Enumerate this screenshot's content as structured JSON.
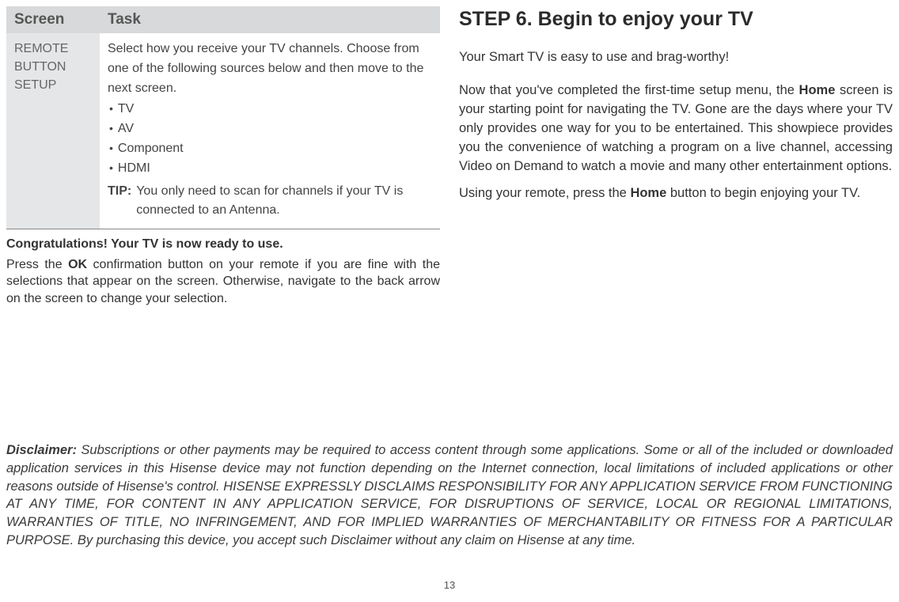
{
  "table": {
    "headers": {
      "screen": "Screen",
      "task": "Task"
    },
    "row": {
      "screen": "REMOTE BUTTON SETUP",
      "task_intro": "Select how you receive your TV channels. Choose from one of the following sources below and then move to the next screen.",
      "bullets": [
        "TV",
        "AV",
        "Component",
        "HDMI"
      ],
      "tip_label": "TIP:",
      "tip_text": "You only need to scan for channels if your TV is connected to an Antenna."
    }
  },
  "below": {
    "congrats": "Congratulations! Your TV is now ready to use.",
    "press_pre": "Press the ",
    "ok": "OK",
    "press_post": " confirmation button on your remote if you are fine with the selections that appear on the screen. Otherwise, navigate to the back arrow on the screen to change your selection."
  },
  "right": {
    "heading": "STEP 6. Begin to enjoy your TV",
    "p1": "Your Smart TV is easy to use and brag-worthy!",
    "p2_pre": "Now that you've completed the first-time setup menu, the ",
    "p2_home": "Home",
    "p2_post": " screen is your starting point for navigating the TV. Gone are the days where your TV only provides one way for you to be entertained. This showpiece provides you the convenience of watching a program on a live channel, accessing Video on Demand to watch a movie and many other entertainment options.",
    "p3_pre": "Using your remote, press the ",
    "p3_home": "Home",
    "p3_post": " button to begin enjoying your TV."
  },
  "disclaimer": {
    "label": "Disclaimer:",
    "text": " Subscriptions or other payments may be required to access content through some applications. Some or all of the included or downloaded application services in this Hisense device may not function depending on the Internet connection, local limitations of included applications or other reasons outside of Hisense's control. HISENSE EXPRESSLY DISCLAIMS RESPONSIBILITY FOR ANY APPLICATION SERVICE FROM FUNCTIONING AT ANY TIME, FOR CONTENT IN ANY APPLICATION SERVICE, FOR DISRUPTIONS OF SERVICE, LOCAL OR REGIONAL LIMITATIONS, WARRANTIES OF TITLE, NO INFRINGEMENT, AND FOR IMPLIED WARRANTIES OF MERCHANTABILITY OR FITNESS FOR A PARTICULAR PURPOSE. By purchasing this device, you accept such Disclaimer without any claim on Hisense at any time."
  },
  "pagenum": "13"
}
